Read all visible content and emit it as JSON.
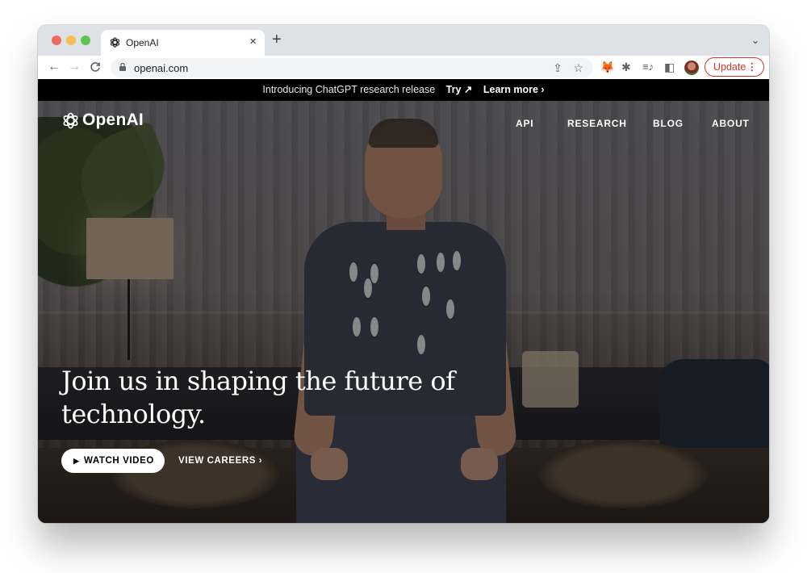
{
  "browser": {
    "tab": {
      "title": "OpenAI",
      "close": "×"
    },
    "new_tab": "+",
    "tab_menu": "⌄",
    "nav": {
      "back": "←",
      "forward": "→",
      "reload": "C"
    },
    "address": {
      "url": "openai.com"
    },
    "omnibox_icons": {
      "share": "⇪",
      "bookmark": "☆"
    },
    "extensions": {
      "metamask": "🦊",
      "puzzle": "✱",
      "media": "≡♪",
      "side_panel": "◧"
    },
    "update_button": {
      "label": "Update",
      "menu": "⋮"
    }
  },
  "announcement": {
    "text": "Introducing ChatGPT research release",
    "try_label": "Try ↗",
    "learn_label": "Learn more ›"
  },
  "site": {
    "logo_text": "OpenAI",
    "nav": [
      {
        "label": "API"
      },
      {
        "label": "RESEARCH"
      },
      {
        "label": "BLOG"
      },
      {
        "label": "ABOUT"
      }
    ],
    "hero": {
      "headline": "Join us in shaping the future of technology.",
      "watch_video": {
        "icon": "▶",
        "label": "WATCH VIDEO"
      },
      "view_careers": "VIEW CAREERS ›"
    }
  },
  "colors": {
    "update_red": "#d93025",
    "traffic_red": "#ec6a5e",
    "traffic_yellow": "#f4bf4f",
    "traffic_green": "#61c554"
  }
}
